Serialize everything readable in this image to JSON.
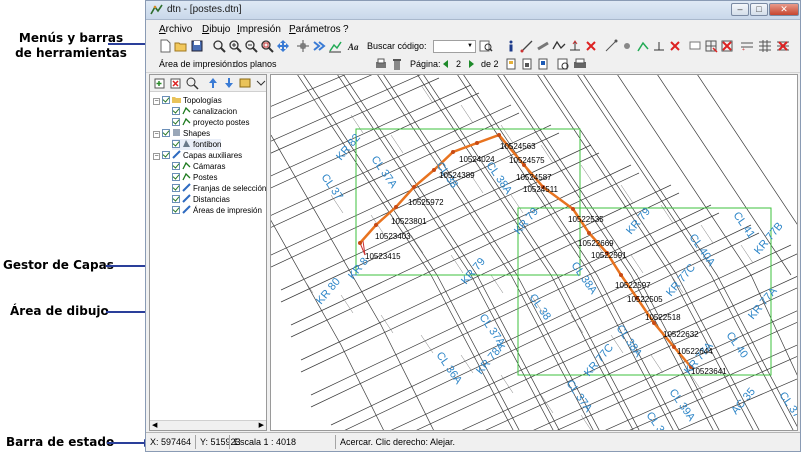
{
  "annotations": {
    "menus": "Menús y barras\nde herramientas",
    "layers": "Gestor de Capas",
    "drawing": "Área de dibujo",
    "status": "Barra de estado"
  },
  "window": {
    "title": "dtn - [postes.dtn]",
    "buttons": {
      "minimize": "–",
      "maximize": "□",
      "close": "✕"
    }
  },
  "menu": [
    "Archivo",
    "Dibujo",
    "Impresión",
    "Parámetros",
    "?"
  ],
  "toolbar": {
    "search_label": "Buscar código:",
    "search_value": "",
    "icons": [
      "new-icon",
      "open-icon",
      "save-icon",
      "zoom-window-icon",
      "zoom-in-icon",
      "zoom-out-icon",
      "zoom-extents-icon",
      "pan-icon",
      "crosshair-icon",
      "forward-icon",
      "chart-icon",
      "text-icon",
      "find-icon",
      "info-icon",
      "line-icon",
      "measure-icon",
      "polyline-icon",
      "delete-icon"
    ]
  },
  "print_toolbar": {
    "area_label": "Área de impresión:",
    "area_value": "dos planos",
    "page_label": "Página:",
    "page_current": "2",
    "page_of": "de 2"
  },
  "layers": {
    "items": [
      {
        "label": "Topologías",
        "level": 0,
        "expander": "−",
        "checked": true
      },
      {
        "label": "canalizacion",
        "level": 1,
        "checked": true
      },
      {
        "label": "proyecto postes",
        "level": 1,
        "checked": true
      },
      {
        "label": "Shapes",
        "level": 0,
        "expander": "−",
        "checked": true
      },
      {
        "label": "fontibon",
        "level": 1,
        "checked": true
      },
      {
        "label": "Capas auxiliares",
        "level": 0,
        "expander": "−",
        "checked": true
      },
      {
        "label": "Cámaras",
        "level": 1,
        "checked": true
      },
      {
        "label": "Postes",
        "level": 1,
        "checked": true
      },
      {
        "label": "Franjas de selección",
        "level": 1,
        "checked": true
      },
      {
        "label": "Distancias",
        "level": 1,
        "checked": true
      },
      {
        "label": "Áreas de impresión",
        "level": 1,
        "checked": true
      }
    ]
  },
  "map": {
    "streets": [
      "KR 82",
      "CL 37A",
      "CL 37",
      "CL 38",
      "CL 38A",
      "KR 79",
      "KR 79",
      "KR 79",
      "KR 80",
      "KR 8",
      "CL 38A",
      "CL 38",
      "CL 37A",
      "CL 36A",
      "KR 78A",
      "KR 77C",
      "KR 77C",
      "CL 38A",
      "CL 37A",
      "CL 39A",
      "KR 77A",
      "KR 77A",
      "CL 40",
      "CL 41",
      "CL 40A",
      "KR 77B",
      "AC 35",
      "CL 35",
      "CL 37"
    ],
    "poles": [
      "10524563",
      "10524024",
      "10524575",
      "10524389",
      "10524587",
      "10524511",
      "10525972",
      "10523801",
      "10523403",
      "10523415",
      "10522535",
      "10522669",
      "10522591",
      "10522597",
      "10522505",
      "10522518",
      "10522632",
      "10522644",
      "10523641"
    ]
  },
  "status": {
    "x": "X: 597464",
    "y": "Y: 515923",
    "scale": "Escala 1 : 4018",
    "hint": "Acercar. Clic derecho: Alejar."
  }
}
